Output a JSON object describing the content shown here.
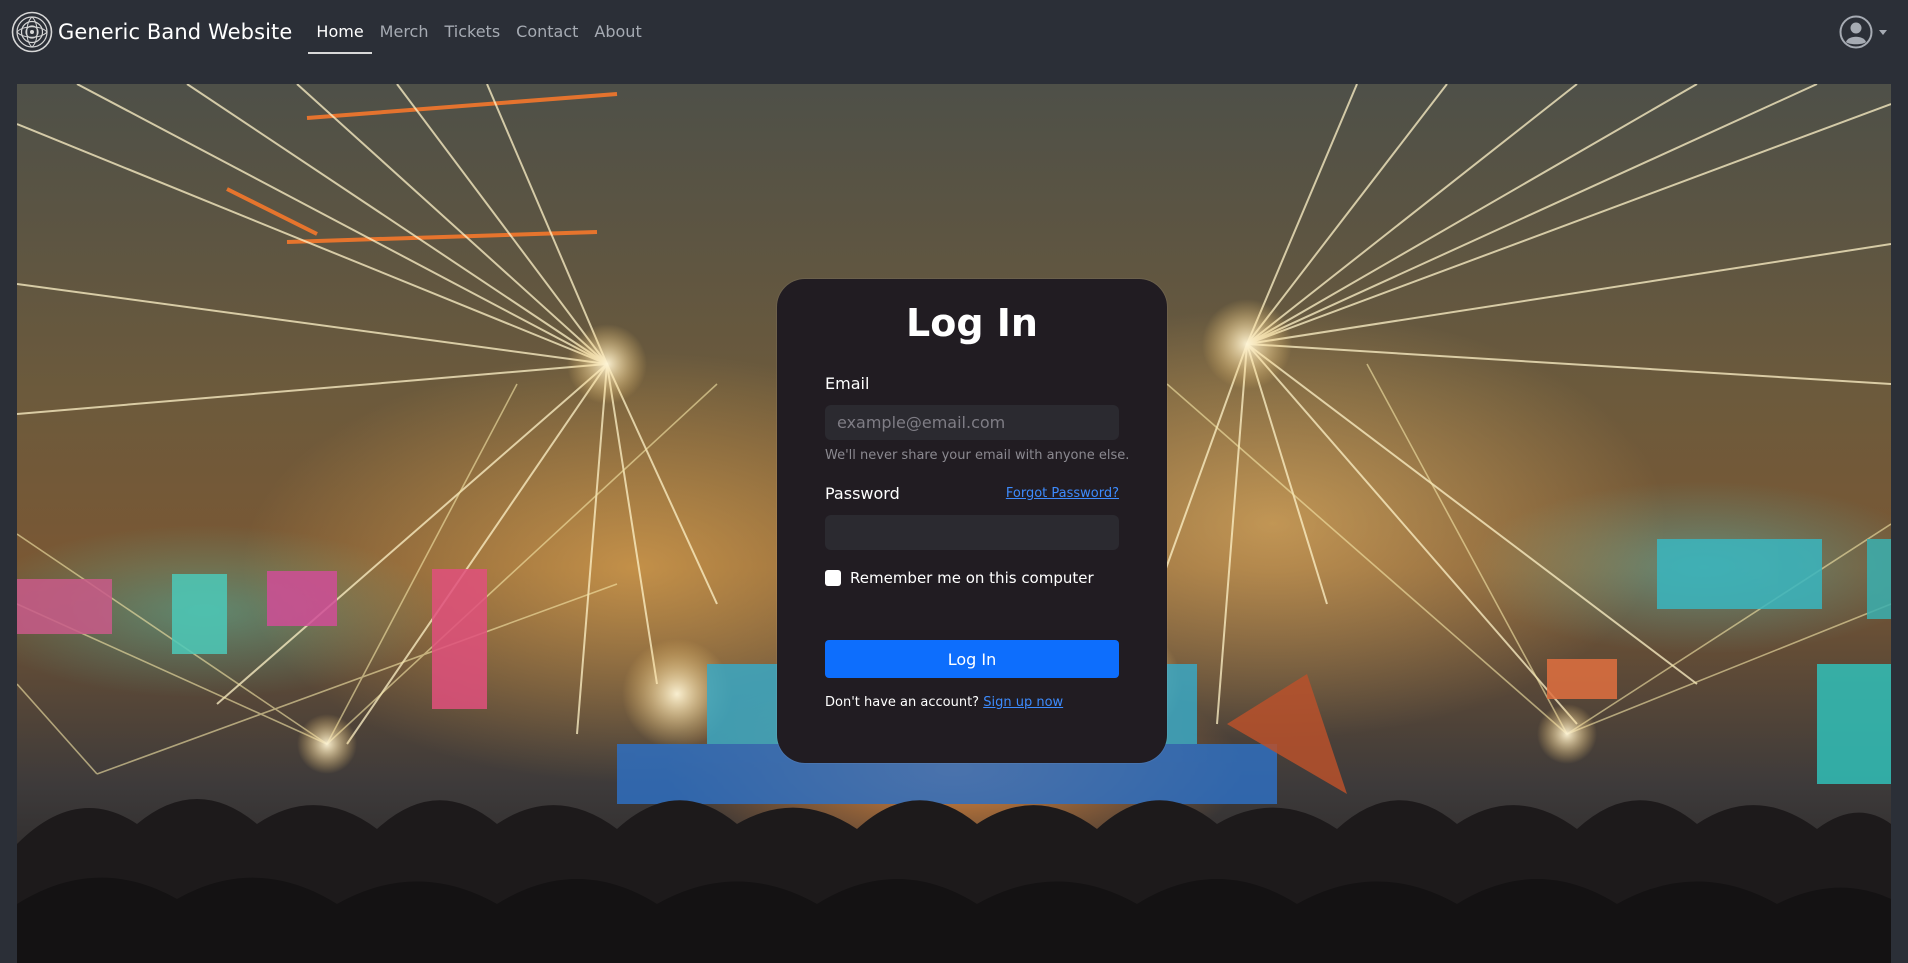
{
  "navbar": {
    "brand": "Generic Band Website",
    "links": [
      {
        "label": "Home",
        "active": true
      },
      {
        "label": "Merch",
        "active": false
      },
      {
        "label": "Tickets",
        "active": false
      },
      {
        "label": "Contact",
        "active": false
      },
      {
        "label": "About",
        "active": false
      }
    ],
    "icons": {
      "logo": "celtic-knot-logo-icon",
      "user": "user-avatar-icon",
      "dropdown": "caret-down-icon"
    }
  },
  "login": {
    "title": "Log In",
    "email_label": "Email",
    "email_placeholder": "example@email.com",
    "email_help": "We'll never share your email with anyone else.",
    "password_label": "Password",
    "forgot_password": "Forgot Password?",
    "remember_label": "Remember me on this computer",
    "remember_checked": false,
    "submit_label": "Log In",
    "signup_prompt": "Don't have an account?",
    "signup_link": "Sign up now"
  },
  "colors": {
    "navbar_bg": "#2b2f37",
    "card_bg": "#211c22",
    "primary": "#0d6efd",
    "link": "#3d8bfd"
  }
}
